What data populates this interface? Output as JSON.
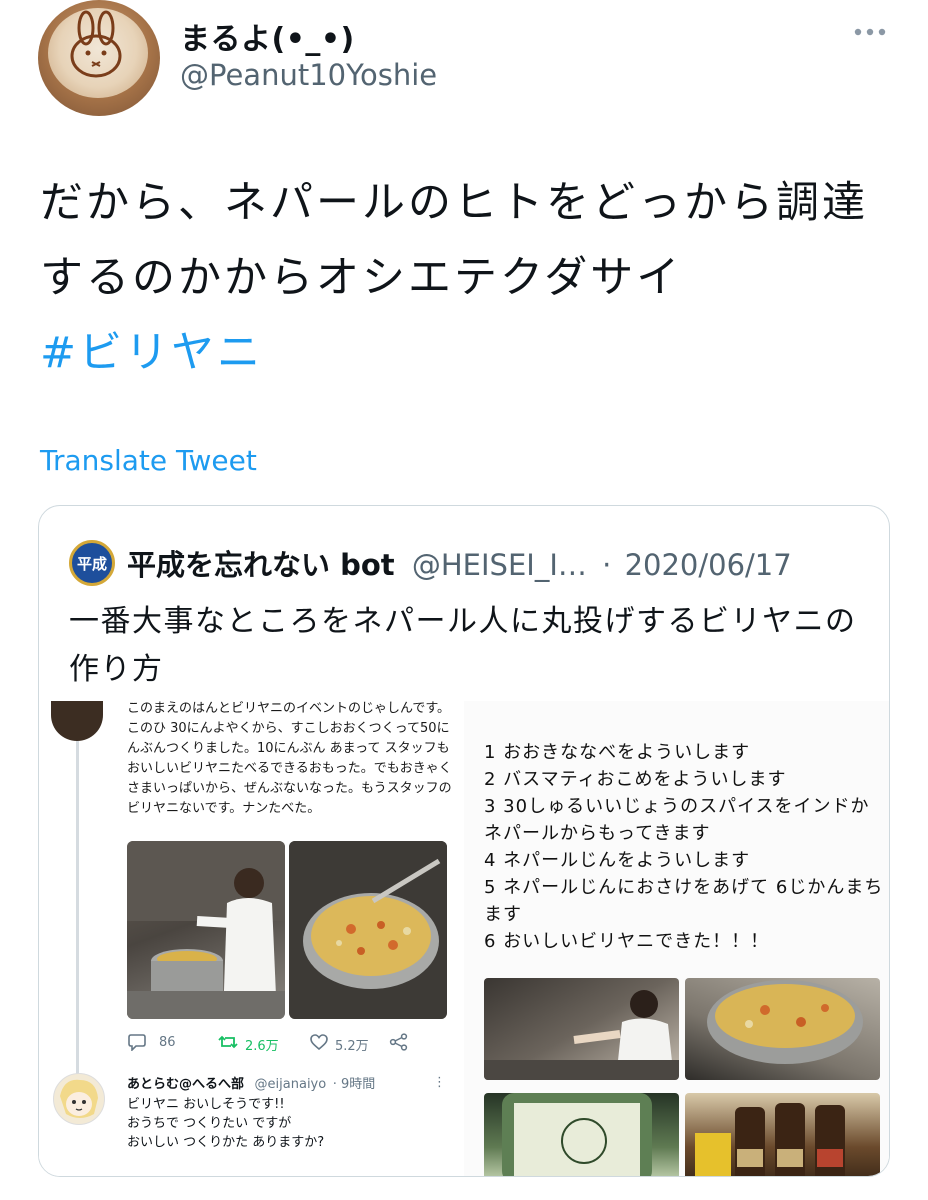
{
  "author": {
    "display_name": "まるよ(•_•)",
    "handle": "@Peanut10Yoshie"
  },
  "tweet": {
    "text": "だから、ネパールのヒトをどっから調達するのかからオシエテクダサイ",
    "hashtag": "#ビリヤニ",
    "translate_label": "Translate Tweet"
  },
  "quote": {
    "avatar_text": "平成",
    "name": "平成を忘れない bot",
    "handle": "@HEISEI_I…",
    "separator": "·",
    "date": "2020/06/17",
    "text": "一番大事なところをネパール人に丸投げするビリヤニの作り方",
    "left_post": {
      "text": "このまえのはんとビリヤニのイベントのじゃしんです。このひ 30にんよやくから、すこしおおくつくって50にんぶんつくりました。10にんぶん あまって スタッフもおいしいビリヤニたべるできるおもった。でもおきゃくさまいっぱいから、ぜんぶないなった。もうスタッフのビリヤニないです。ナンたべた。",
      "reply_count": "86",
      "retweet_count": "2.6万",
      "like_count": "5.2万"
    },
    "reply": {
      "name": "あとらむ@へるへ部",
      "handle": "@eijanaiyo",
      "time": "· 9時間",
      "lines": [
        "ビリヤニ おいしそうです!!",
        "おうちで つくりたい ですが",
        "おいしい つくりかた ありますか?"
      ]
    },
    "recipe_lines": [
      "1 おおきななべをよういします",
      "2 バスマティおこめをよういします",
      "3 30しゅるいいじょうのスパイスをインドかネパールからもってきます",
      "4 ネパールじんをよういします",
      "5 ネパールじんにおさけをあげて 6じかんまちます",
      "6 おいしいビリヤニできた！！！"
    ]
  },
  "colors": {
    "link": "#1d9bf0",
    "muted": "#536471",
    "border": "#cfd9de",
    "retweet_green": "#17bf63"
  },
  "icons": [
    "more-icon",
    "reply-icon",
    "retweet-icon",
    "like-icon",
    "share-icon"
  ]
}
